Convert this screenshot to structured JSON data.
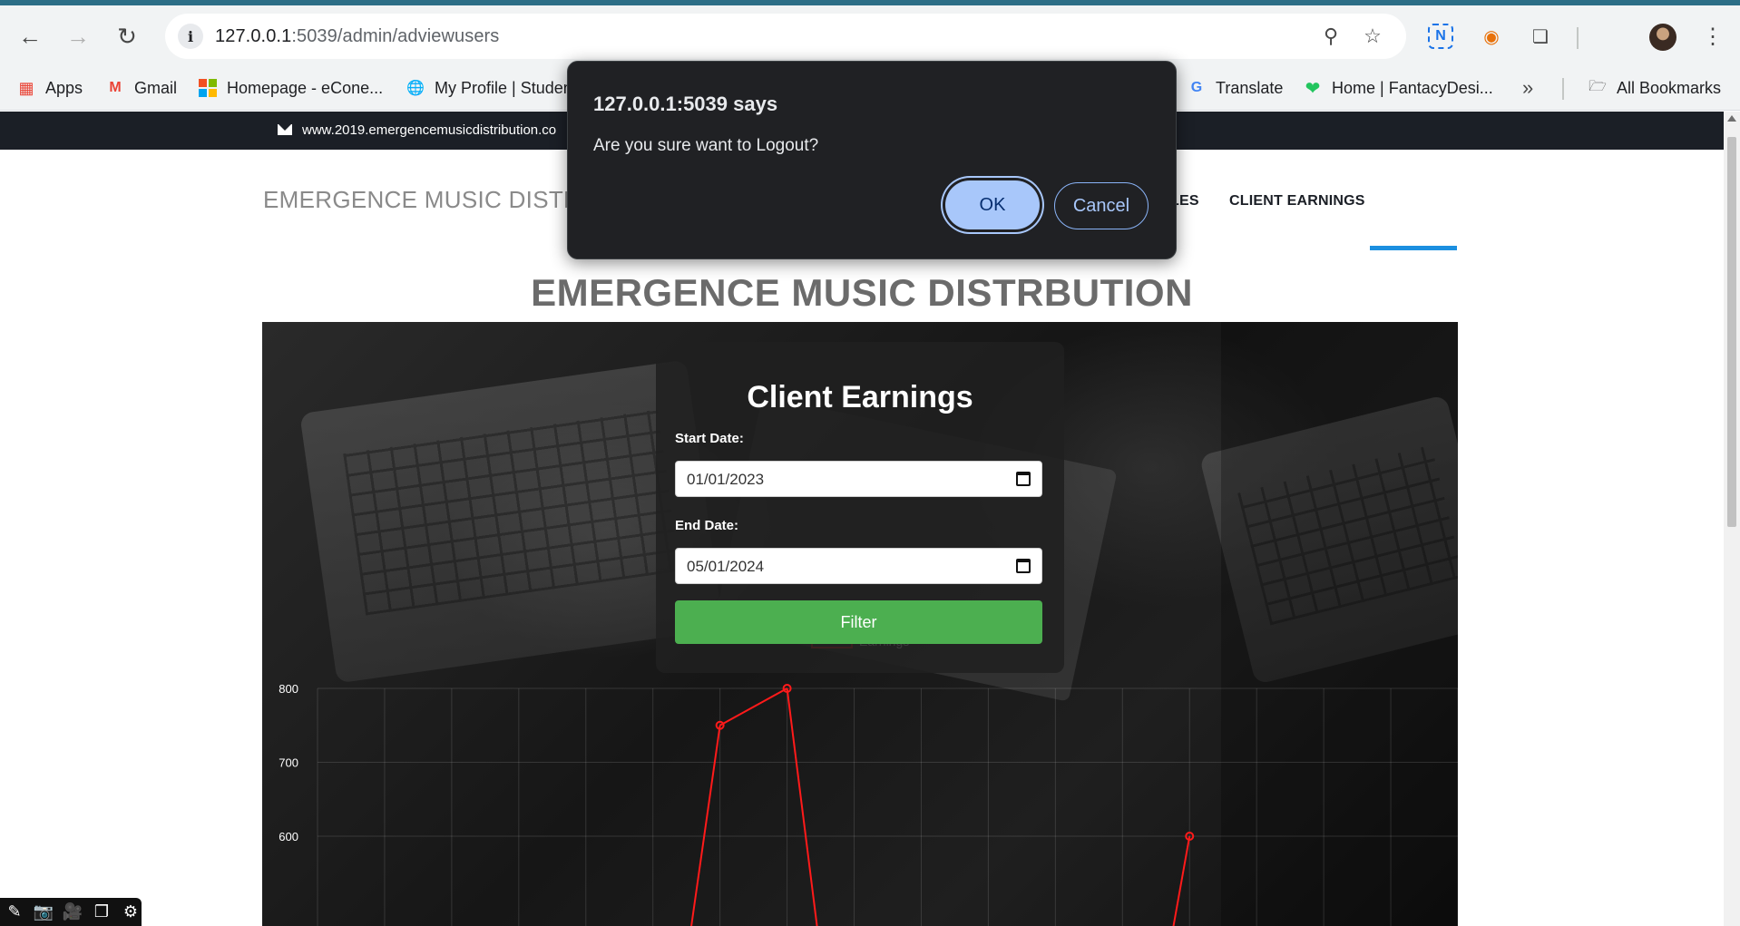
{
  "browser": {
    "url_host": "127.0.0.1",
    "url_rest": ":5039/admin/adviewusers",
    "bookmarks": [
      {
        "label": "Apps",
        "icon": "apps-grid-icon"
      },
      {
        "label": "Gmail",
        "icon": "gmail-icon"
      },
      {
        "label": "Homepage - eCone...",
        "icon": "microsoft-icon"
      },
      {
        "label": "My Profile | Studen",
        "icon": "globe-icon"
      },
      {
        "label": "Translate",
        "icon": "translate-icon"
      },
      {
        "label": "Home | FantacyDesi...",
        "icon": "heart-icon"
      },
      {
        "label": "All Bookmarks",
        "icon": "folder-icon"
      }
    ]
  },
  "site": {
    "top_url": "www.2019.emergencemusicdistribution.co",
    "brand": "EMERGENCE MUSIC DISTRE",
    "nav": [
      {
        "label": "LES"
      },
      {
        "label": "CLIENT EARNINGS",
        "active": true
      }
    ],
    "main_title": "EMERGENCE MUSIC DISTRBUTION"
  },
  "filter": {
    "title": "Client Earnings",
    "start_label": "Start Date:",
    "start_value": "01/01/2023",
    "end_label": "End Date:",
    "end_value": "05/01/2024",
    "button": "Filter"
  },
  "chart_data": {
    "type": "line",
    "series": [
      {
        "name": "Earnings",
        "color": "#ff1a1a",
        "points": [
          {
            "index": 6,
            "y": 750
          },
          {
            "index": 7,
            "y": 800
          },
          {
            "index": 13,
            "y": 600
          }
        ]
      }
    ],
    "y_ticks": [
      800,
      700,
      600
    ],
    "ylim_visible": [
      600,
      800
    ],
    "grid": true,
    "legend": "top-center"
  },
  "dialog": {
    "title": "127.0.0.1:5039 says",
    "message": "Are you sure want to Logout?",
    "ok": "OK",
    "cancel": "Cancel"
  },
  "colors": {
    "accent_blue": "#1b8fe0",
    "filter_green": "#4caf50",
    "dialog_ok": "#a8c7fa"
  }
}
